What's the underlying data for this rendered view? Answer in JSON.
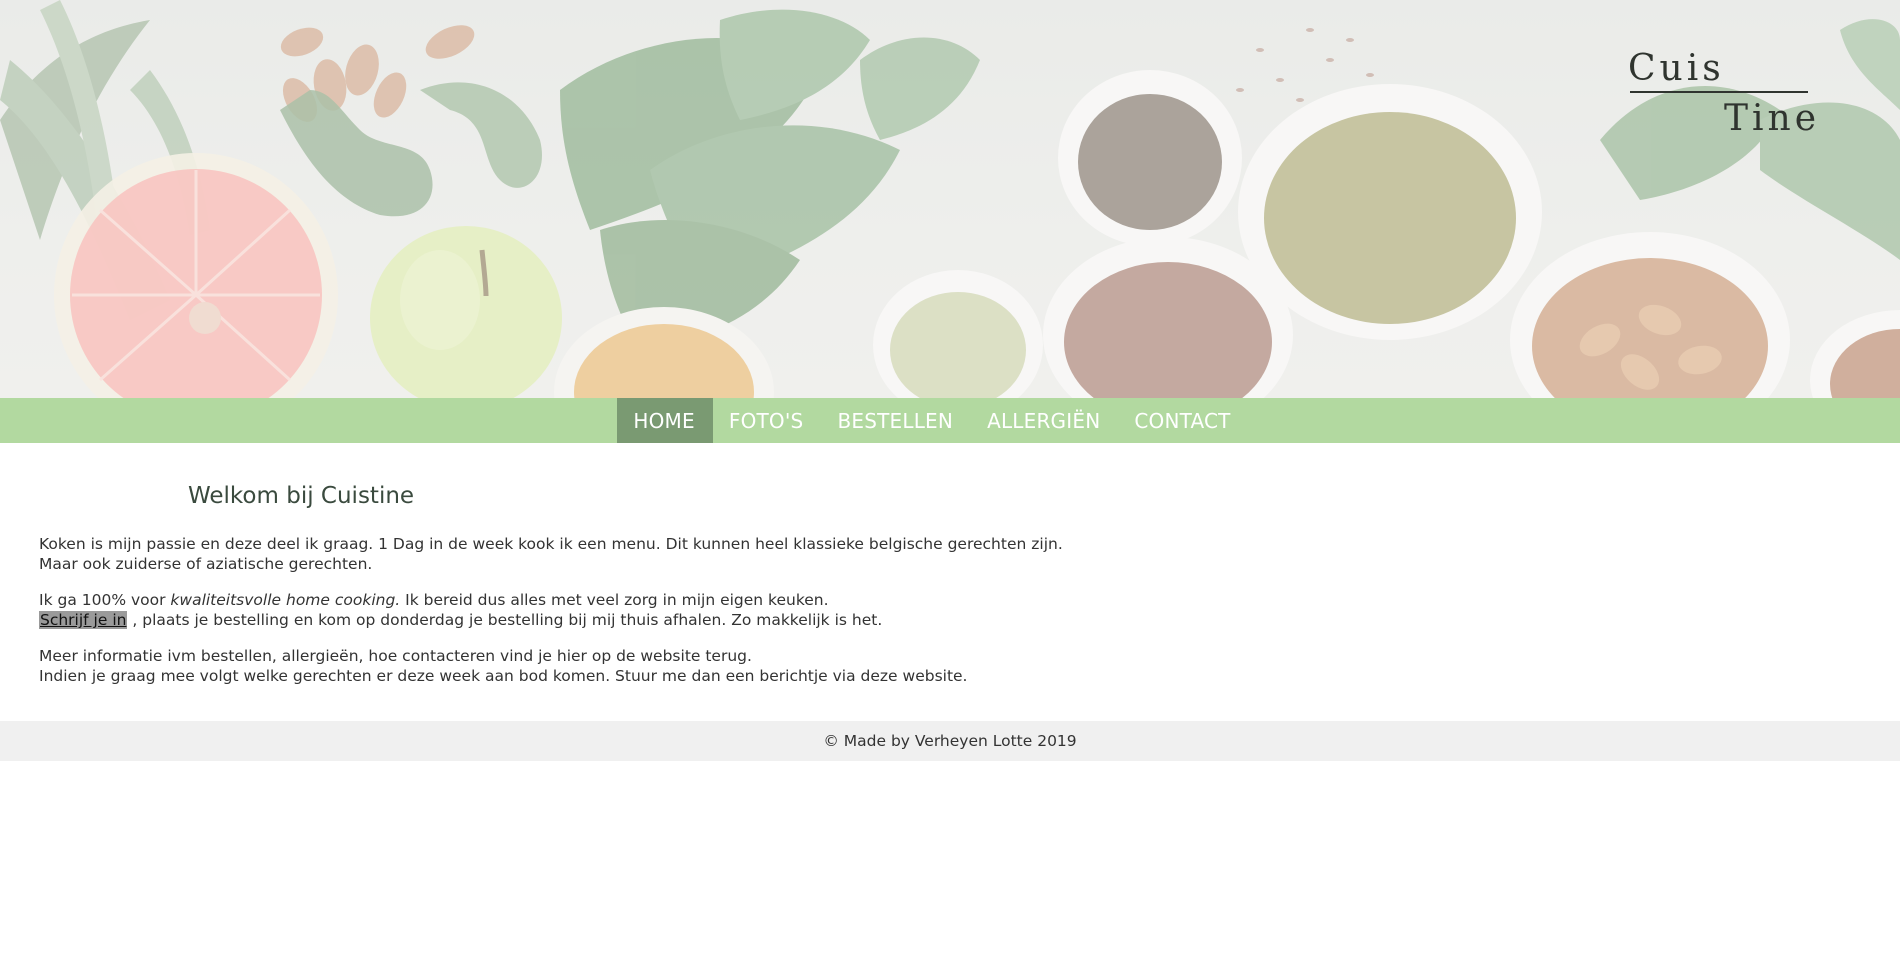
{
  "hero": {
    "image_icon": "vegetables-spices-banner-image",
    "logo": {
      "line1": "Cuis",
      "line2": "Tine"
    }
  },
  "nav": {
    "items": [
      {
        "label": "HOME",
        "active": true
      },
      {
        "label": "FOTO'S",
        "active": false
      },
      {
        "label": "BESTELLEN",
        "active": false
      },
      {
        "label": "ALLERGIËN",
        "active": false
      },
      {
        "label": "CONTACT",
        "active": false
      }
    ]
  },
  "main": {
    "title": "Welkom bij Cuistine",
    "p1_line1": "Koken is mijn passie en deze deel ik graag. 1 Dag in de week kook ik een menu. Dit kunnen heel klassieke belgische gerechten zijn.",
    "p1_line2": "Maar ook zuiderse of aziatische gerechten.",
    "p2_prefix": "Ik ga 100% voor ",
    "p2_emphasis": "kwaliteitsvolle home cooking.",
    "p2_suffix": " Ik bereid dus alles met veel zorg in mijn eigen keuken.",
    "signup_link": "Schrijf je in",
    "p2_line2_rest": " , plaats je bestelling en kom op donderdag je bestelling bij mij thuis afhalen. Zo makkelijk is het.",
    "p3_line1": "Meer informatie ivm bestellen, allergieën, hoe contacteren vind je hier op de website terug.",
    "p3_line2": "Indien je graag mee volgt welke gerechten er deze week aan bod komen. Stuur me dan een berichtje via deze website."
  },
  "footer": {
    "text": "© Made by Verheyen Lotte 2019"
  },
  "colors": {
    "nav_bg": "#b2d9a0",
    "nav_active": "#7a9a72",
    "footer_bg": "#f0f0f0",
    "link_highlight": "#9a9a9a"
  }
}
